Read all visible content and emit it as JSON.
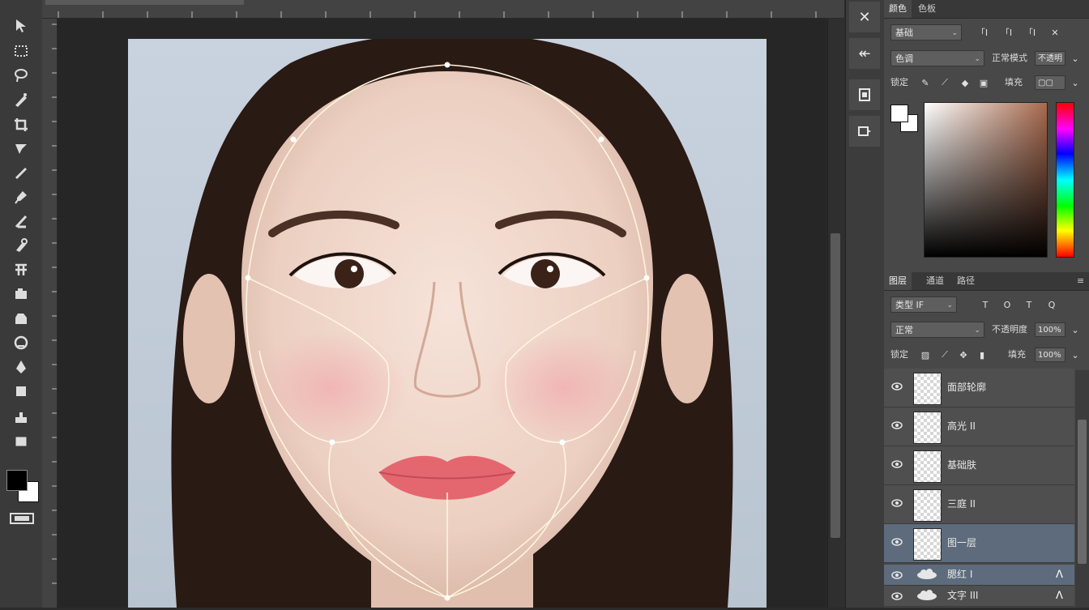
{
  "toolbar": {
    "tools": [
      "move-tool-icon",
      "marquee-tool-icon",
      "lasso-tool-icon",
      "quick-select-tool-icon",
      "crop-tool-icon",
      "eyedropper-tool-icon",
      "healing-brush-icon",
      "brush-tool-icon",
      "clone-stamp-icon",
      "history-brush-icon",
      "eraser-tool-icon",
      "gradient-tool-icon",
      "blur-tool-icon",
      "dodge-tool-icon",
      "pen-tool-icon",
      "type-tool-icon",
      "path-select-icon",
      "shape-tool-icon",
      "hand-tool-icon",
      "zoom-tool-icon"
    ],
    "fg_color": "#000000",
    "bg_color": "#ffffff"
  },
  "mini_panel": {
    "close_glyph": "✕",
    "back_glyph": "↞"
  },
  "color_panel": {
    "tabs": [
      "颜色",
      "色板"
    ],
    "row1": {
      "dropdown": "基础",
      "icons": [
        "「I",
        "「I",
        "「I"
      ]
    },
    "row2": {
      "dropdown": "色调",
      "label": "正常模式",
      "value": "不透明"
    },
    "row3": {
      "label": "锁定",
      "value": "填充"
    },
    "hue_accent": "#a86a4e"
  },
  "layers_panel": {
    "tabs": [
      "图层",
      "通道",
      "路径"
    ],
    "filter": {
      "dropdown": "类型 IF",
      "icons": [
        "T",
        "O",
        "T",
        "Q"
      ]
    },
    "blend": {
      "dropdown": "正常",
      "label": "不透明度",
      "value": "100%"
    },
    "lock": {
      "label": "锁定",
      "fill_label": "填充",
      "fill_value": "100%"
    },
    "layers": [
      {
        "name": "面部轮廓",
        "selected": false
      },
      {
        "name": "高光 II",
        "selected": false
      },
      {
        "name": "基础肤",
        "selected": false
      },
      {
        "name": "三庭 II",
        "selected": false
      },
      {
        "name": "图一层",
        "selected": true
      }
    ],
    "small_layers": [
      {
        "name": "腮红 I",
        "selected": true
      },
      {
        "name": "文字 III",
        "selected": false
      }
    ]
  },
  "canvas": {
    "bg_color": "#c5cfdb",
    "guide_color": "#fff6e0"
  }
}
